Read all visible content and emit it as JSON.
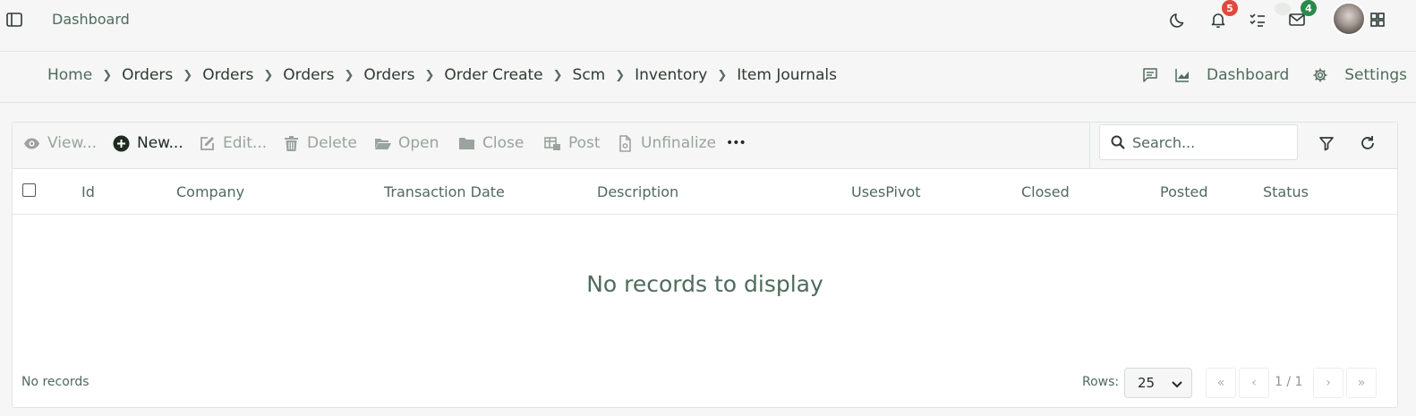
{
  "topbar": {
    "title": "Dashboard",
    "notifications_count": "5",
    "mail_count": "4",
    "icons": [
      "sidebar-toggle-icon",
      "moon-icon",
      "bell-icon",
      "tasks-icon",
      "mail-icon",
      "avatar",
      "apps-grid-icon"
    ]
  },
  "breadcrumb": {
    "items": [
      "Home",
      "Orders",
      "Orders",
      "Orders",
      "Orders",
      "Order Create",
      "Scm",
      "Inventory",
      "Item Journals"
    ]
  },
  "subbar_actions": {
    "dashboard_label": "Dashboard",
    "settings_label": "Settings"
  },
  "toolbar": {
    "view": "View...",
    "new": "New...",
    "edit": "Edit...",
    "delete": "Delete",
    "open": "Open",
    "close": "Close",
    "post": "Post",
    "unfinalize": "Unfinalize",
    "more": "•••",
    "search_placeholder": "Search..."
  },
  "table": {
    "columns": [
      "Id",
      "Company",
      "Transaction Date",
      "Description",
      "UsesPivot",
      "Closed",
      "Posted",
      "Status"
    ],
    "rows": [],
    "empty_message": "No records to display"
  },
  "footer": {
    "records_text": "No records",
    "rows_label": "Rows:",
    "rows_per_page": "25",
    "rows_options": [
      "25"
    ],
    "page_info": "1 / 1",
    "first": "«",
    "prev": "‹",
    "next": "›",
    "last": "»"
  },
  "colors": {
    "accent_text": "#4f6b5b",
    "badge_red": "#e2483d",
    "badge_green": "#2b8a4b"
  }
}
